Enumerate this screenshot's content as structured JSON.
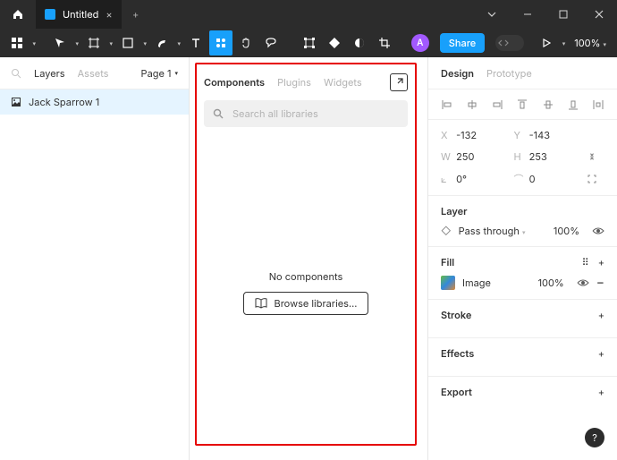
{
  "titlebar": {
    "title": "Untitled"
  },
  "toolbar": {
    "zoom": "100%"
  },
  "avatar_initial": "A",
  "share_label": "Share",
  "left": {
    "tabs": {
      "layers": "Layers",
      "assets": "Assets",
      "pages": "Page 1"
    },
    "layer_name": "Jack Sparrow 1"
  },
  "components": {
    "tabs": {
      "components": "Components",
      "plugins": "Plugins",
      "widgets": "Widgets"
    },
    "search_placeholder": "Search all libraries",
    "empty_text": "No components",
    "browse_label": "Browse libraries..."
  },
  "right": {
    "tabs": {
      "design": "Design",
      "prototype": "Prototype"
    },
    "x": "-132",
    "y": "-143",
    "w": "250",
    "h": "253",
    "rot": "0°",
    "rad": "0",
    "layer_label": "Layer",
    "blend": "Pass through",
    "layer_opacity": "100%",
    "fill_label": "Fill",
    "fill_type": "Image",
    "fill_opacity": "100%",
    "stroke_label": "Stroke",
    "effects_label": "Effects",
    "export_label": "Export"
  }
}
